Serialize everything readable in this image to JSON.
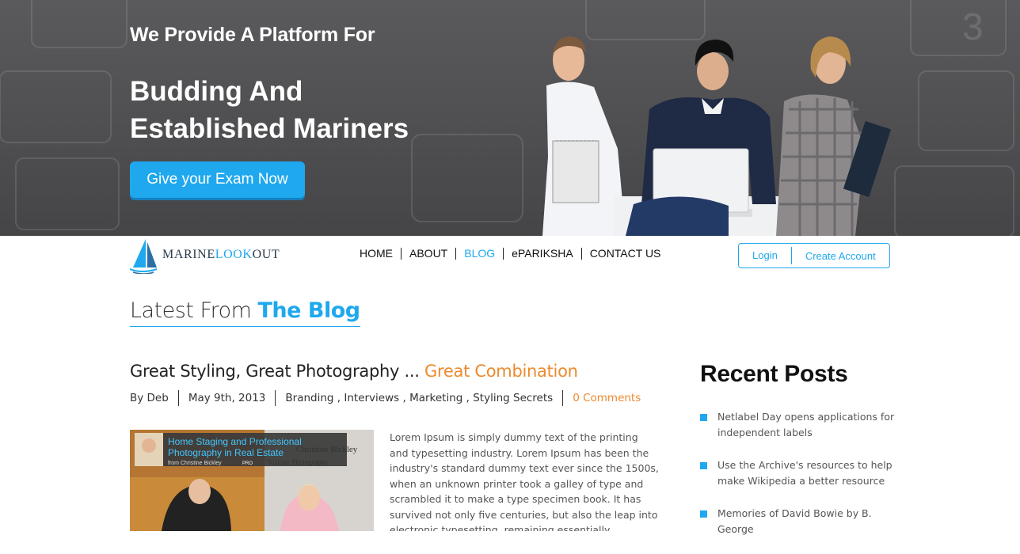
{
  "hero": {
    "line1": "We Provide A Platform For",
    "line2": "Budding And Established Mariners",
    "cta_label": "Give your Exam Now"
  },
  "logo": {
    "part1": "MARINE",
    "part2": "LOOK",
    "part3": "OUT"
  },
  "nav": {
    "items": [
      {
        "label": "HOME"
      },
      {
        "label": "ABOUT"
      },
      {
        "label": "BLOG",
        "active": true
      },
      {
        "label": "ePARIKSHA"
      },
      {
        "label": "CONTACT US"
      }
    ]
  },
  "auth": {
    "login_label": "Login",
    "create_label": "Create Account"
  },
  "section": {
    "title_plain": "Latest From",
    "title_accent": "The Blog"
  },
  "post": {
    "title_main": "Great Styling, Great Photography ...",
    "title_accent": "Great Combination",
    "author": "By Deb",
    "date": "May 9th, 2013",
    "categories": [
      "Branding",
      "Interviews",
      "Marketing",
      "Styling Secrets"
    ],
    "comments": "0 Comments",
    "thumb_caption_line1": "Home Staging and Professional",
    "thumb_caption_line2": "Photography in Real Estate",
    "thumb_from": "from Christine Bickley",
    "thumb_badge": "PRO",
    "thumb_name": "Christine Bickley",
    "thumb_studio": "Vizionz Photography",
    "excerpt": "Lorem Ipsum is simply dummy text of the printing and typesetting industry. Lorem Ipsum has been the industry's standard dummy text ever since the 1500s, when an unknown printer took a galley of type and scrambled it to make a type specimen book. It has survived not only five centuries, but also the leap into electronic typesetting, remaining essentially unchanged."
  },
  "sidebar": {
    "title": "Recent Posts",
    "posts": [
      {
        "label": "Netlabel Day opens applications for independent labels"
      },
      {
        "label": "Use the Archive's resources to help make Wikipedia a better resource"
      },
      {
        "label": "Memories of David Bowie by B. George"
      }
    ]
  },
  "colors": {
    "accent": "#1fa8ee",
    "orange": "#ec8a2f",
    "hero_bg": "#505052"
  }
}
